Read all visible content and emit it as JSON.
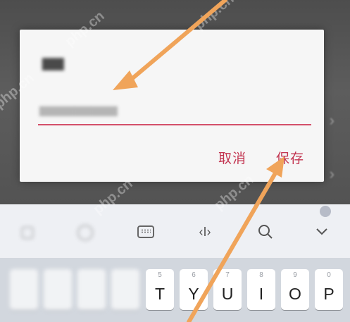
{
  "dialog": {
    "cancel_label": "取消",
    "save_label": "保存"
  },
  "keyboard": {
    "keys": [
      {
        "letter": "T",
        "number": "5"
      },
      {
        "letter": "Y",
        "number": "6"
      },
      {
        "letter": "U",
        "number": "7"
      },
      {
        "letter": "I",
        "number": "8"
      },
      {
        "letter": "O",
        "number": "9"
      },
      {
        "letter": "P",
        "number": "0"
      }
    ],
    "toolbar": {
      "cursor_glyph": "‹I›"
    }
  },
  "watermark": "php.cn",
  "colors": {
    "accent": "#c2334f",
    "arrow": "#f0a45a",
    "dialog_bg": "#f6f6f6",
    "keyboard_bg": "#d2d7de"
  }
}
